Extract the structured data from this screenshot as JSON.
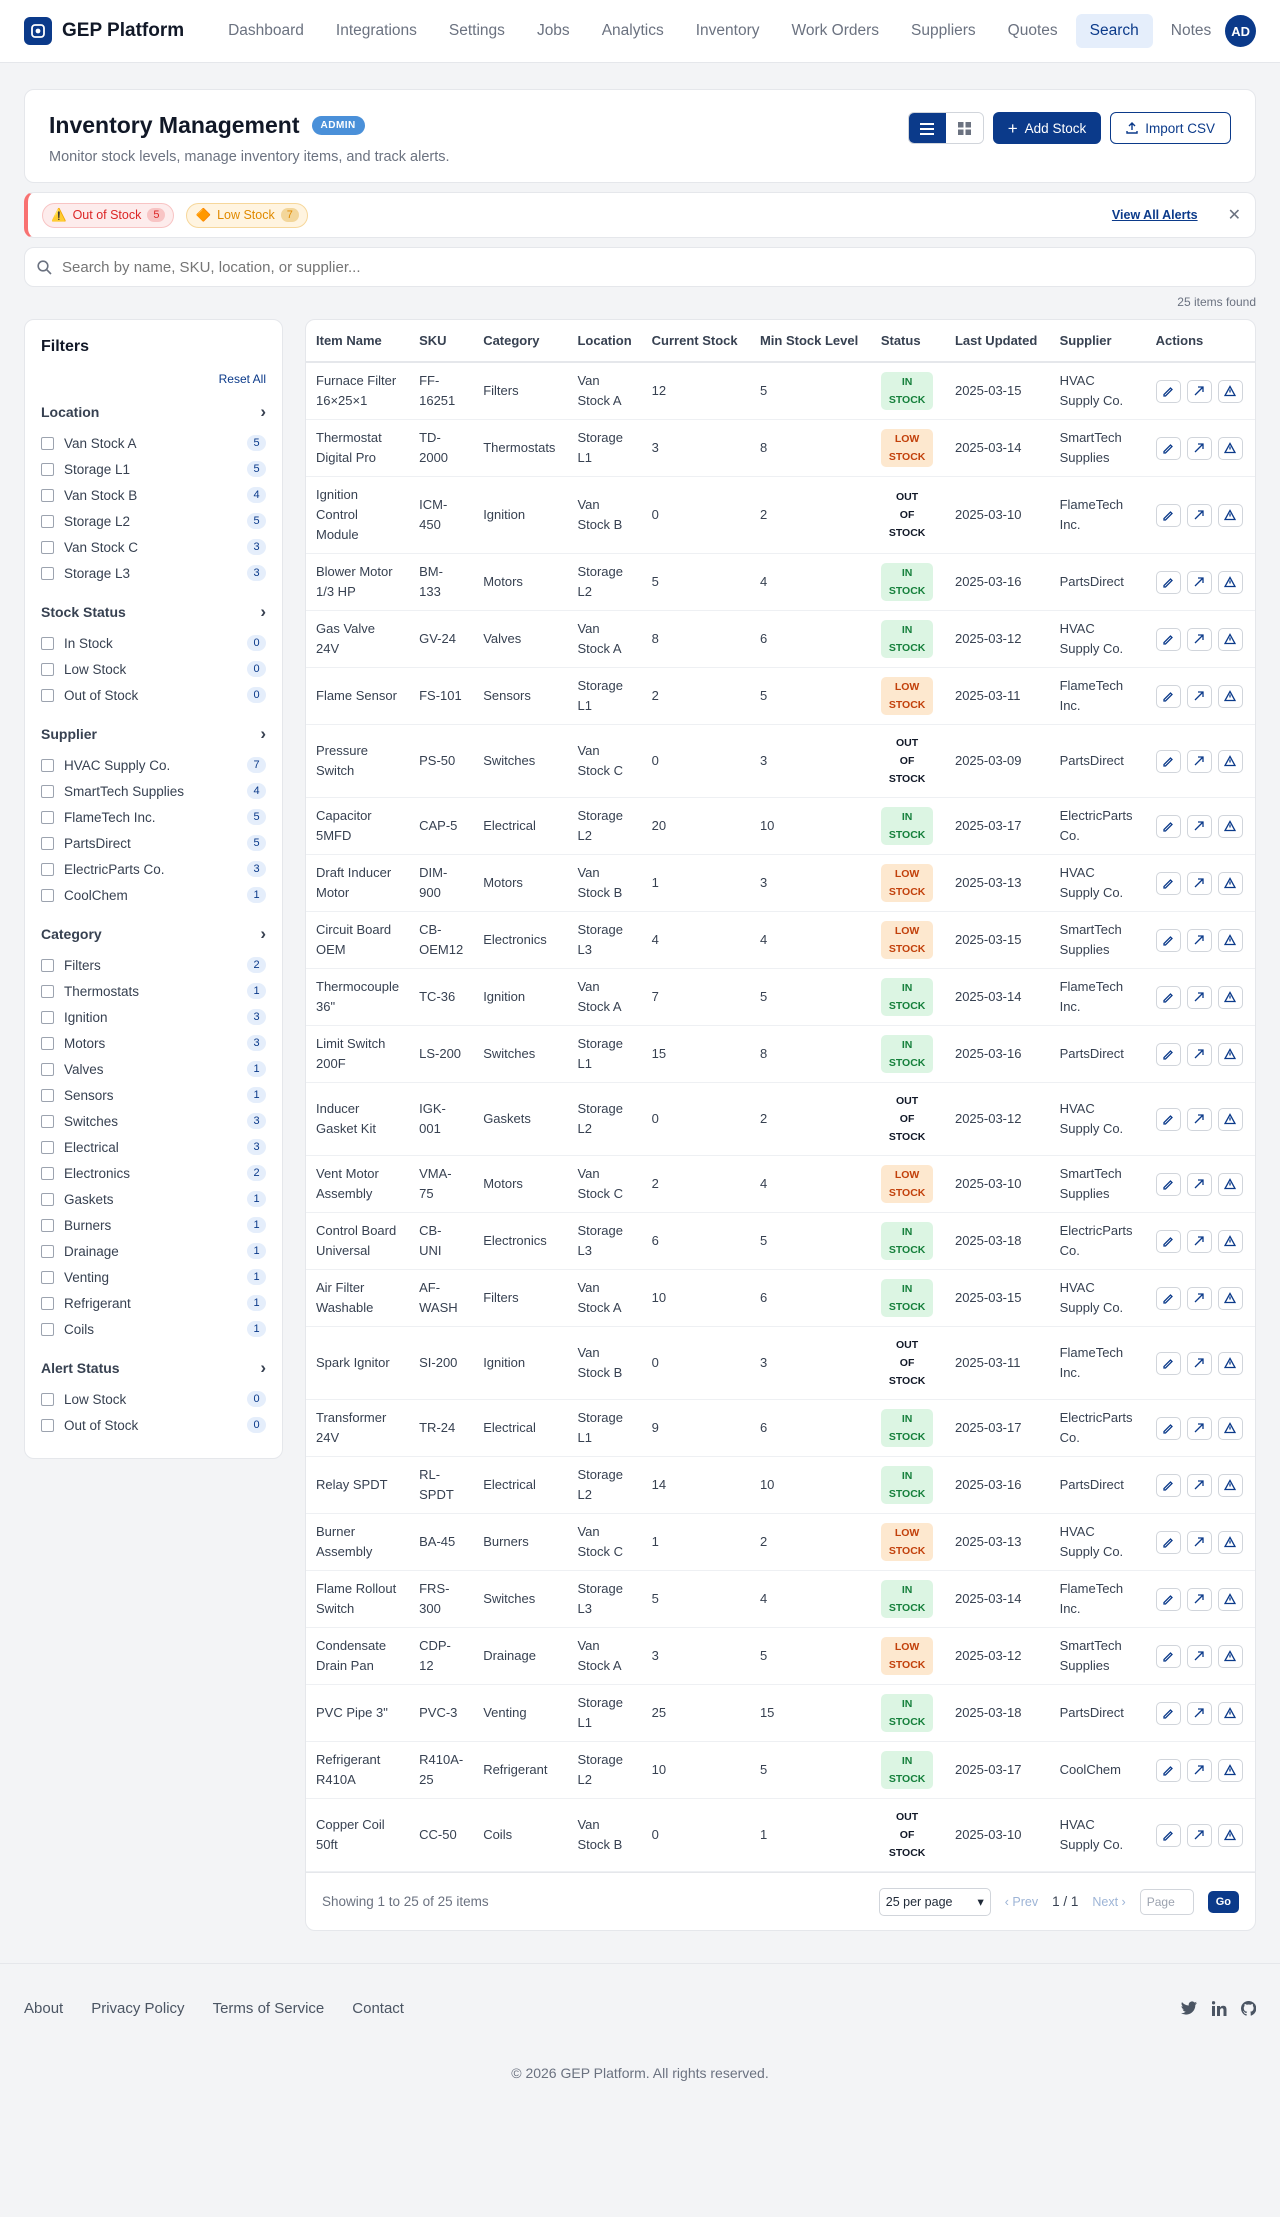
{
  "app": {
    "name": "GEP Platform",
    "avatar_initials": "AD"
  },
  "nav": [
    "Dashboard",
    "Integrations",
    "Settings",
    "Jobs",
    "Analytics",
    "Inventory",
    "Work Orders",
    "Suppliers",
    "Quotes",
    "Search",
    "Notes"
  ],
  "nav_active": "Search",
  "header": {
    "title": "Inventory Management",
    "badge": "ADMIN",
    "subtitle": "Monitor stock levels, manage inventory items, and track alerts.",
    "add_stock": "Add Stock",
    "import_csv": "Import CSV"
  },
  "alerts": {
    "out_label": "Out of Stock",
    "out_count": "5",
    "low_label": "Low Stock",
    "low_count": "7",
    "view_all": "View All Alerts"
  },
  "search": {
    "placeholder": "Search by name, SKU, location, or supplier..."
  },
  "items_found": "25 items found",
  "filters": {
    "title": "Filters",
    "reset": "Reset All",
    "sections": [
      {
        "title": "Location",
        "options": [
          [
            "Van Stock A",
            "5"
          ],
          [
            "Storage L1",
            "5"
          ],
          [
            "Van Stock B",
            "4"
          ],
          [
            "Storage L2",
            "5"
          ],
          [
            "Van Stock C",
            "3"
          ],
          [
            "Storage L3",
            "3"
          ]
        ]
      },
      {
        "title": "Stock Status",
        "options": [
          [
            "In Stock",
            "0"
          ],
          [
            "Low Stock",
            "0"
          ],
          [
            "Out of Stock",
            "0"
          ]
        ]
      },
      {
        "title": "Supplier",
        "options": [
          [
            "HVAC Supply Co.",
            "7"
          ],
          [
            "SmartTech Supplies",
            "4"
          ],
          [
            "FlameTech Inc.",
            "5"
          ],
          [
            "PartsDirect",
            "5"
          ],
          [
            "ElectricParts Co.",
            "3"
          ],
          [
            "CoolChem",
            "1"
          ]
        ]
      },
      {
        "title": "Category",
        "options": [
          [
            "Filters",
            "2"
          ],
          [
            "Thermostats",
            "1"
          ],
          [
            "Ignition",
            "3"
          ],
          [
            "Motors",
            "3"
          ],
          [
            "Valves",
            "1"
          ],
          [
            "Sensors",
            "1"
          ],
          [
            "Switches",
            "3"
          ],
          [
            "Electrical",
            "3"
          ],
          [
            "Electronics",
            "2"
          ],
          [
            "Gaskets",
            "1"
          ],
          [
            "Burners",
            "1"
          ],
          [
            "Drainage",
            "1"
          ],
          [
            "Venting",
            "1"
          ],
          [
            "Refrigerant",
            "1"
          ],
          [
            "Coils",
            "1"
          ]
        ]
      },
      {
        "title": "Alert Status",
        "options": [
          [
            "Low Stock",
            "0"
          ],
          [
            "Out of Stock",
            "0"
          ]
        ]
      }
    ]
  },
  "table": {
    "columns": [
      "Item Name",
      "SKU",
      "Category",
      "Location",
      "Current Stock",
      "Min Stock Level",
      "Status",
      "Last Updated",
      "Supplier",
      "Actions"
    ],
    "rows": [
      [
        "Furnace Filter 16×25×1",
        "FF-16251",
        "Filters",
        "Van Stock A",
        "12",
        "5",
        "IN STOCK",
        "2025-03-15",
        "HVAC Supply Co."
      ],
      [
        "Thermostat Digital Pro",
        "TD-2000",
        "Thermostats",
        "Storage L1",
        "3",
        "8",
        "LOW STOCK",
        "2025-03-14",
        "SmartTech Supplies"
      ],
      [
        "Ignition Control Module",
        "ICM-450",
        "Ignition",
        "Van Stock B",
        "0",
        "2",
        "OUT OF STOCK",
        "2025-03-10",
        "FlameTech Inc."
      ],
      [
        "Blower Motor 1/3 HP",
        "BM-133",
        "Motors",
        "Storage L2",
        "5",
        "4",
        "IN STOCK",
        "2025-03-16",
        "PartsDirect"
      ],
      [
        "Gas Valve 24V",
        "GV-24",
        "Valves",
        "Van Stock A",
        "8",
        "6",
        "IN STOCK",
        "2025-03-12",
        "HVAC Supply Co."
      ],
      [
        "Flame Sensor",
        "FS-101",
        "Sensors",
        "Storage L1",
        "2",
        "5",
        "LOW STOCK",
        "2025-03-11",
        "FlameTech Inc."
      ],
      [
        "Pressure Switch",
        "PS-50",
        "Switches",
        "Van Stock C",
        "0",
        "3",
        "OUT OF STOCK",
        "2025-03-09",
        "PartsDirect"
      ],
      [
        "Capacitor 5MFD",
        "CAP-5",
        "Electrical",
        "Storage L2",
        "20",
        "10",
        "IN STOCK",
        "2025-03-17",
        "ElectricParts Co."
      ],
      [
        "Draft Inducer Motor",
        "DIM-900",
        "Motors",
        "Van Stock B",
        "1",
        "3",
        "LOW STOCK",
        "2025-03-13",
        "HVAC Supply Co."
      ],
      [
        "Circuit Board OEM",
        "CB-OEM12",
        "Electronics",
        "Storage L3",
        "4",
        "4",
        "LOW STOCK",
        "2025-03-15",
        "SmartTech Supplies"
      ],
      [
        "Thermocouple 36\"",
        "TC-36",
        "Ignition",
        "Van Stock A",
        "7",
        "5",
        "IN STOCK",
        "2025-03-14",
        "FlameTech Inc."
      ],
      [
        "Limit Switch 200F",
        "LS-200",
        "Switches",
        "Storage L1",
        "15",
        "8",
        "IN STOCK",
        "2025-03-16",
        "PartsDirect"
      ],
      [
        "Inducer Gasket Kit",
        "IGK-001",
        "Gaskets",
        "Storage L2",
        "0",
        "2",
        "OUT OF STOCK",
        "2025-03-12",
        "HVAC Supply Co."
      ],
      [
        "Vent Motor Assembly",
        "VMA-75",
        "Motors",
        "Van Stock C",
        "2",
        "4",
        "LOW STOCK",
        "2025-03-10",
        "SmartTech Supplies"
      ],
      [
        "Control Board Universal",
        "CB-UNI",
        "Electronics",
        "Storage L3",
        "6",
        "5",
        "IN STOCK",
        "2025-03-18",
        "ElectricParts Co."
      ],
      [
        "Air Filter Washable",
        "AF-WASH",
        "Filters",
        "Van Stock A",
        "10",
        "6",
        "IN STOCK",
        "2025-03-15",
        "HVAC Supply Co."
      ],
      [
        "Spark Ignitor",
        "SI-200",
        "Ignition",
        "Van Stock B",
        "0",
        "3",
        "OUT OF STOCK",
        "2025-03-11",
        "FlameTech Inc."
      ],
      [
        "Transformer 24V",
        "TR-24",
        "Electrical",
        "Storage L1",
        "9",
        "6",
        "IN STOCK",
        "2025-03-17",
        "ElectricParts Co."
      ],
      [
        "Relay SPDT",
        "RL-SPDT",
        "Electrical",
        "Storage L2",
        "14",
        "10",
        "IN STOCK",
        "2025-03-16",
        "PartsDirect"
      ],
      [
        "Burner Assembly",
        "BA-45",
        "Burners",
        "Van Stock C",
        "1",
        "2",
        "LOW STOCK",
        "2025-03-13",
        "HVAC Supply Co."
      ],
      [
        "Flame Rollout Switch",
        "FRS-300",
        "Switches",
        "Storage L3",
        "5",
        "4",
        "IN STOCK",
        "2025-03-14",
        "FlameTech Inc."
      ],
      [
        "Condensate Drain Pan",
        "CDP-12",
        "Drainage",
        "Van Stock A",
        "3",
        "5",
        "LOW STOCK",
        "2025-03-12",
        "SmartTech Supplies"
      ],
      [
        "PVC Pipe 3\"",
        "PVC-3",
        "Venting",
        "Storage L1",
        "25",
        "15",
        "IN STOCK",
        "2025-03-18",
        "PartsDirect"
      ],
      [
        "Refrigerant R410A",
        "R410A-25",
        "Refrigerant",
        "Storage L2",
        "10",
        "5",
        "IN STOCK",
        "2025-03-17",
        "CoolChem"
      ],
      [
        "Copper Coil 50ft",
        "CC-50",
        "Coils",
        "Van Stock B",
        "0",
        "1",
        "OUT OF STOCK",
        "2025-03-10",
        "HVAC Supply Co."
      ]
    ]
  },
  "pagination": {
    "info": "Showing 1 to 25 of 25 items",
    "per_page": "25 per page",
    "prev": "‹ Prev",
    "page": "1 / 1",
    "next": "Next ›",
    "page_placeholder": "Page",
    "go": "Go"
  },
  "footer": {
    "links": [
      "About",
      "Privacy Policy",
      "Terms of Service",
      "Contact"
    ],
    "copyright": "© 2026 GEP Platform. All rights reserved."
  },
  "colors": {
    "brand": "#0b3a8a",
    "in_stock": "#16803c",
    "low_stock": "#c2410c",
    "out_stock": "#dc2626"
  }
}
